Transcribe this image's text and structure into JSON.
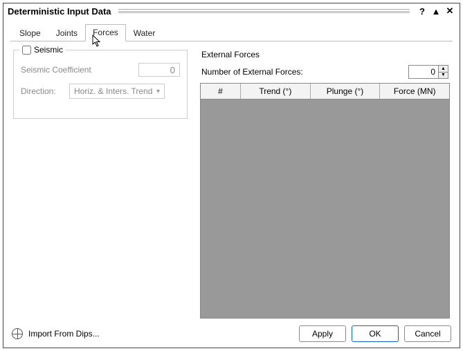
{
  "window": {
    "title": "Deterministic Input Data"
  },
  "tabs": [
    "Slope",
    "Joints",
    "Forces",
    "Water"
  ],
  "active_tab": "Forces",
  "seismic": {
    "legend": "Seismic",
    "checked": false,
    "coefficient_label": "Seismic Coefficient",
    "coefficient_value": "0",
    "direction_label": "Direction:",
    "direction_value": "Horiz. & Inters. Trend"
  },
  "external": {
    "title": "External Forces",
    "count_label": "Number of External Forces:",
    "count_value": "0",
    "columns": [
      "#",
      "Trend (°)",
      "Plunge (°)",
      "Force (MN)"
    ]
  },
  "footer": {
    "import": "Import From Dips...",
    "apply": "Apply",
    "ok": "OK",
    "cancel": "Cancel"
  }
}
